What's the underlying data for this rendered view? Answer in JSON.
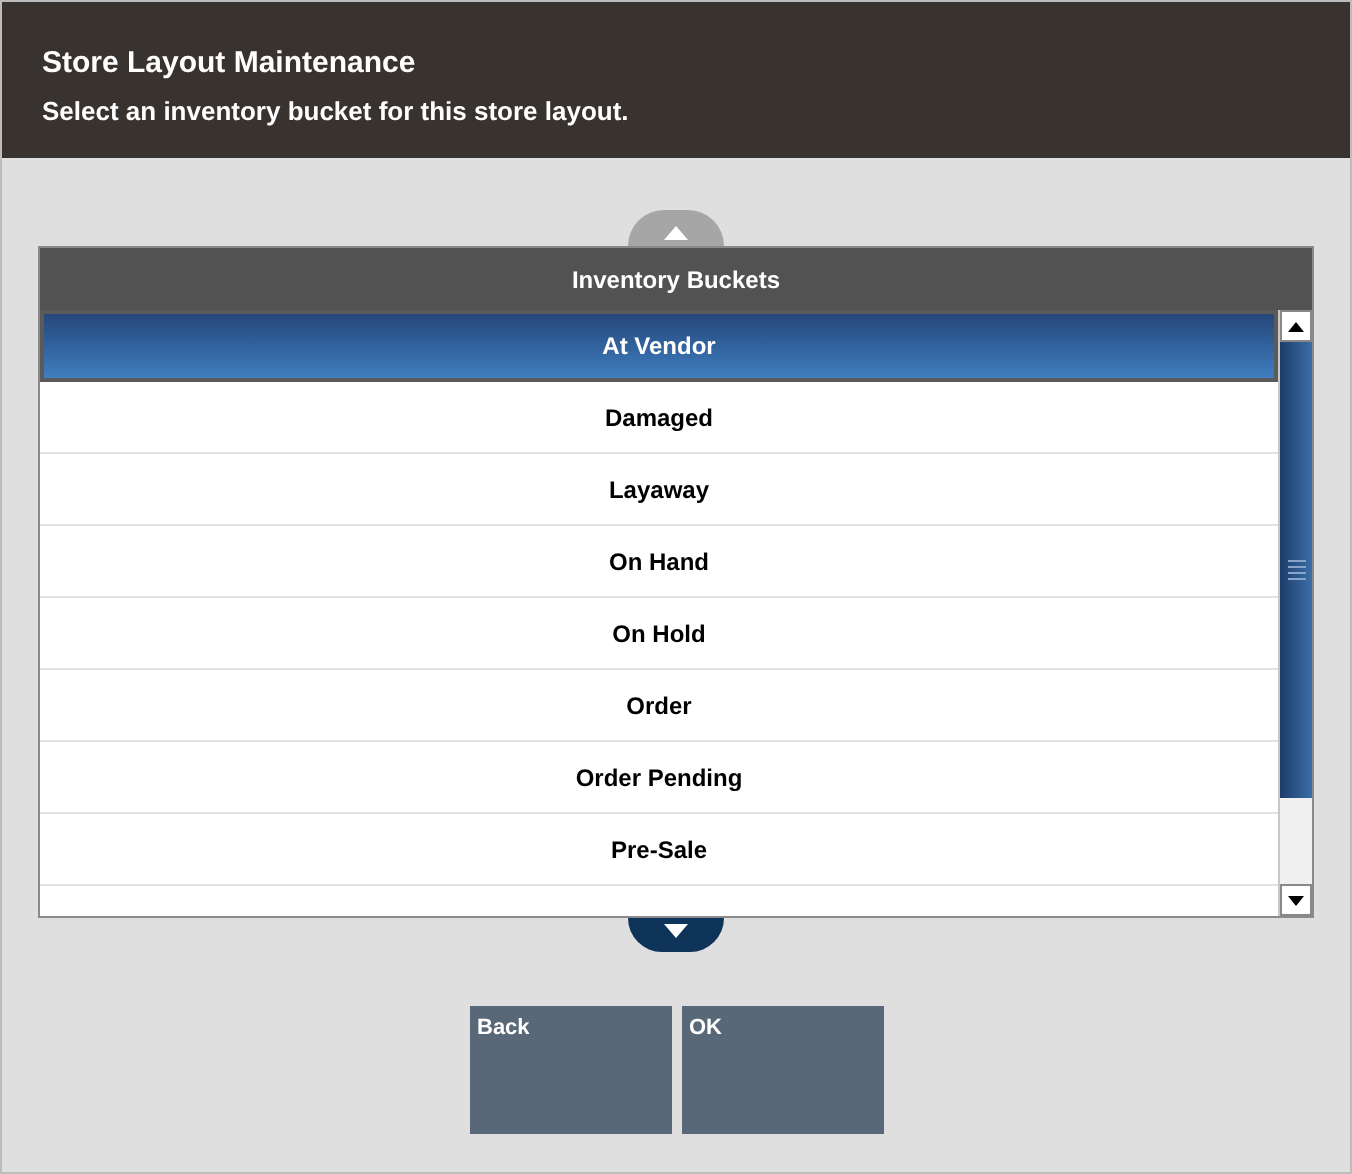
{
  "header": {
    "title": "Store Layout Maintenance",
    "subtitle": "Select an inventory bucket for this store layout."
  },
  "list": {
    "heading": "Inventory Buckets",
    "items": [
      {
        "label": "At Vendor",
        "selected": true
      },
      {
        "label": "Damaged",
        "selected": false
      },
      {
        "label": "Layaway",
        "selected": false
      },
      {
        "label": "On Hand",
        "selected": false
      },
      {
        "label": "On Hold",
        "selected": false
      },
      {
        "label": "Order",
        "selected": false
      },
      {
        "label": "Order Pending",
        "selected": false
      },
      {
        "label": "Pre-Sale",
        "selected": false
      }
    ]
  },
  "buttons": [
    "Back",
    "OK"
  ]
}
